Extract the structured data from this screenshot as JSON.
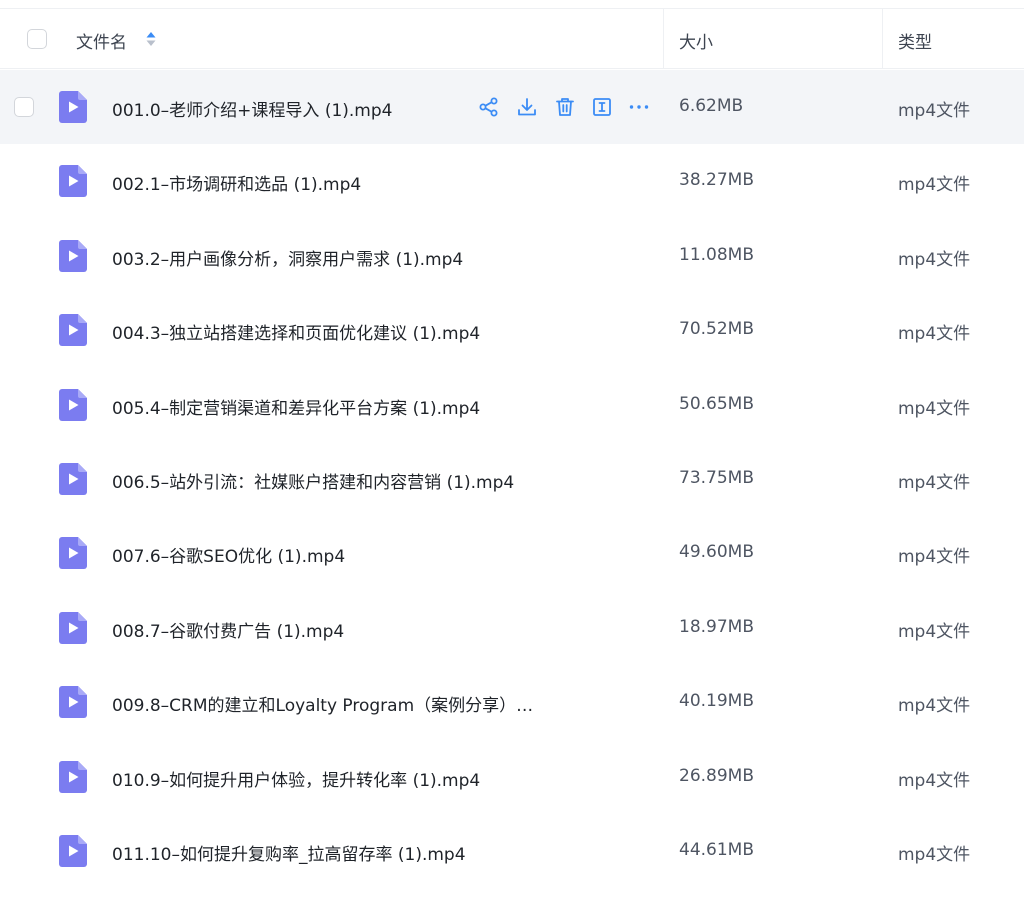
{
  "header": {
    "name_label": "文件名",
    "size_label": "大小",
    "type_label": "类型"
  },
  "colors": {
    "accent": "#3b8cf5",
    "file_icon": "#7b7cf0",
    "hover_row": "#f3f5f8"
  },
  "files": [
    {
      "name": "001.0–老师介绍+课程导入 (1).mp4",
      "size": "6.62MB",
      "type": "mp4文件"
    },
    {
      "name": "002.1–市场调研和选品 (1).mp4",
      "size": "38.27MB",
      "type": "mp4文件"
    },
    {
      "name": "003.2–用户画像分析，洞察用户需求 (1).mp4",
      "size": "11.08MB",
      "type": "mp4文件"
    },
    {
      "name": "004.3–独立站搭建选择和页面优化建议 (1).mp4",
      "size": "70.52MB",
      "type": "mp4文件"
    },
    {
      "name": "005.4–制定营销渠道和差异化平台方案 (1).mp4",
      "size": "50.65MB",
      "type": "mp4文件"
    },
    {
      "name": "006.5–站外引流：社媒账户搭建和内容营销 (1).mp4",
      "size": "73.75MB",
      "type": "mp4文件"
    },
    {
      "name": "007.6–谷歌SEO优化 (1).mp4",
      "size": "49.60MB",
      "type": "mp4文件"
    },
    {
      "name": "008.7–谷歌付费广告 (1).mp4",
      "size": "18.97MB",
      "type": "mp4文件"
    },
    {
      "name": "009.8–CRM的建立和Loyalty Program（案例分享）…",
      "size": "40.19MB",
      "type": "mp4文件"
    },
    {
      "name": "010.9–如何提升用户体验，提升转化率 (1).mp4",
      "size": "26.89MB",
      "type": "mp4文件"
    },
    {
      "name": "011.10–如何提升复购率_拉高留存率 (1).mp4",
      "size": "44.61MB",
      "type": "mp4文件"
    }
  ],
  "row_actions": [
    "share-icon",
    "download-icon",
    "trash-icon",
    "rename-icon",
    "more-icon"
  ]
}
